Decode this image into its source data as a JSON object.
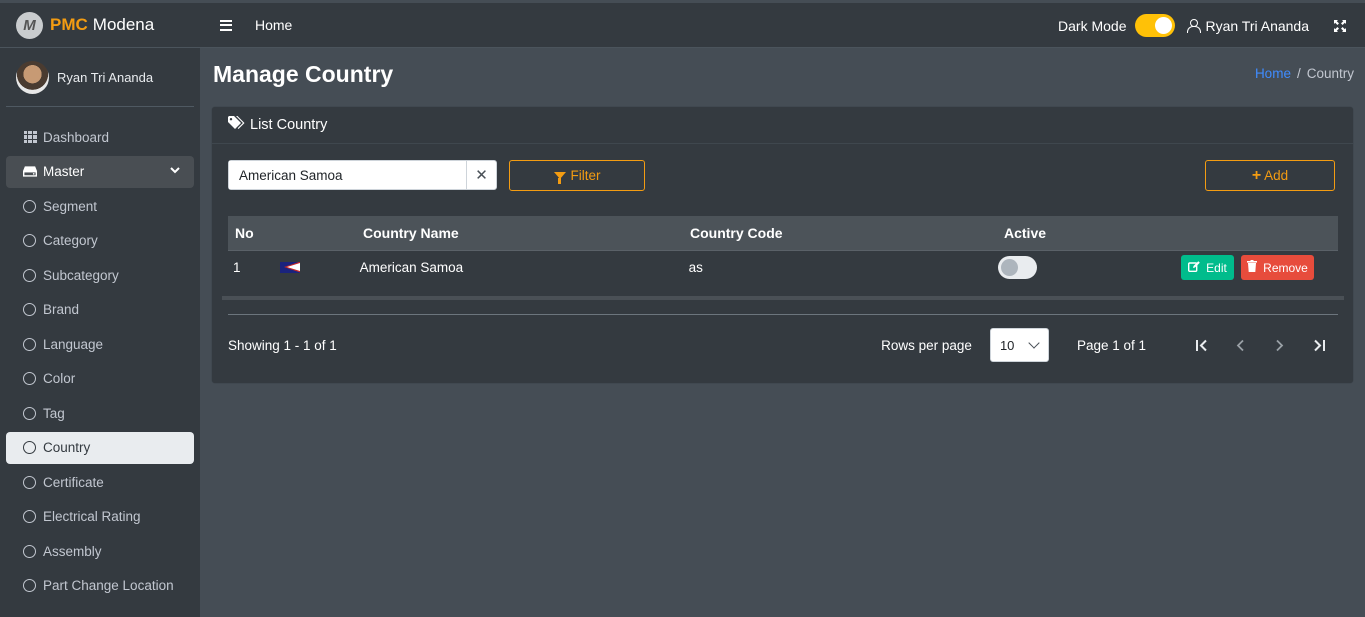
{
  "brand": {
    "logo_letter": "M",
    "name_bold": "PMC",
    "name": "Modena"
  },
  "user": {
    "name": "Ryan Tri Ananda"
  },
  "sidebar": {
    "items": [
      {
        "label": "Dashboard",
        "icon": "grid-icon"
      },
      {
        "label": "Master",
        "icon": "hdd-icon"
      },
      {
        "label": "Segment"
      },
      {
        "label": "Category"
      },
      {
        "label": "Subcategory"
      },
      {
        "label": "Brand"
      },
      {
        "label": "Language"
      },
      {
        "label": "Color"
      },
      {
        "label": "Tag"
      },
      {
        "label": "Country"
      },
      {
        "label": "Certificate"
      },
      {
        "label": "Electrical Rating"
      },
      {
        "label": "Assembly"
      },
      {
        "label": "Part Change Location"
      }
    ]
  },
  "topbar": {
    "home": "Home",
    "dark_mode_label": "Dark Mode",
    "dark_mode_on": true,
    "user_name": "Ryan Tri Ananda"
  },
  "page": {
    "title": "Manage Country"
  },
  "breadcrumb": {
    "home": "Home",
    "sep": "/",
    "current": "Country"
  },
  "card": {
    "title": "List Country",
    "search_value": "American Samoa",
    "filter_label": "Filter",
    "add_label": "Add"
  },
  "table": {
    "headers": {
      "no": "No",
      "name": "Country Name",
      "code": "Country Code",
      "active": "Active"
    },
    "rows": [
      {
        "no": "1",
        "flag": "american-samoa-flag",
        "name": "American Samoa",
        "code": "as",
        "active": false
      }
    ],
    "edit_label": "Edit",
    "remove_label": "Remove"
  },
  "pagination": {
    "showing": "Showing 1 - 1 of 1",
    "rows_per_page_label": "Rows per page",
    "rows_per_page": "10",
    "page_info": "Page 1 of 1"
  },
  "colors": {
    "accent": "#f39c12",
    "toggle": "#ffc107",
    "edit": "#00bc8c",
    "remove": "#e74c3c",
    "link": "#3f8cff"
  }
}
